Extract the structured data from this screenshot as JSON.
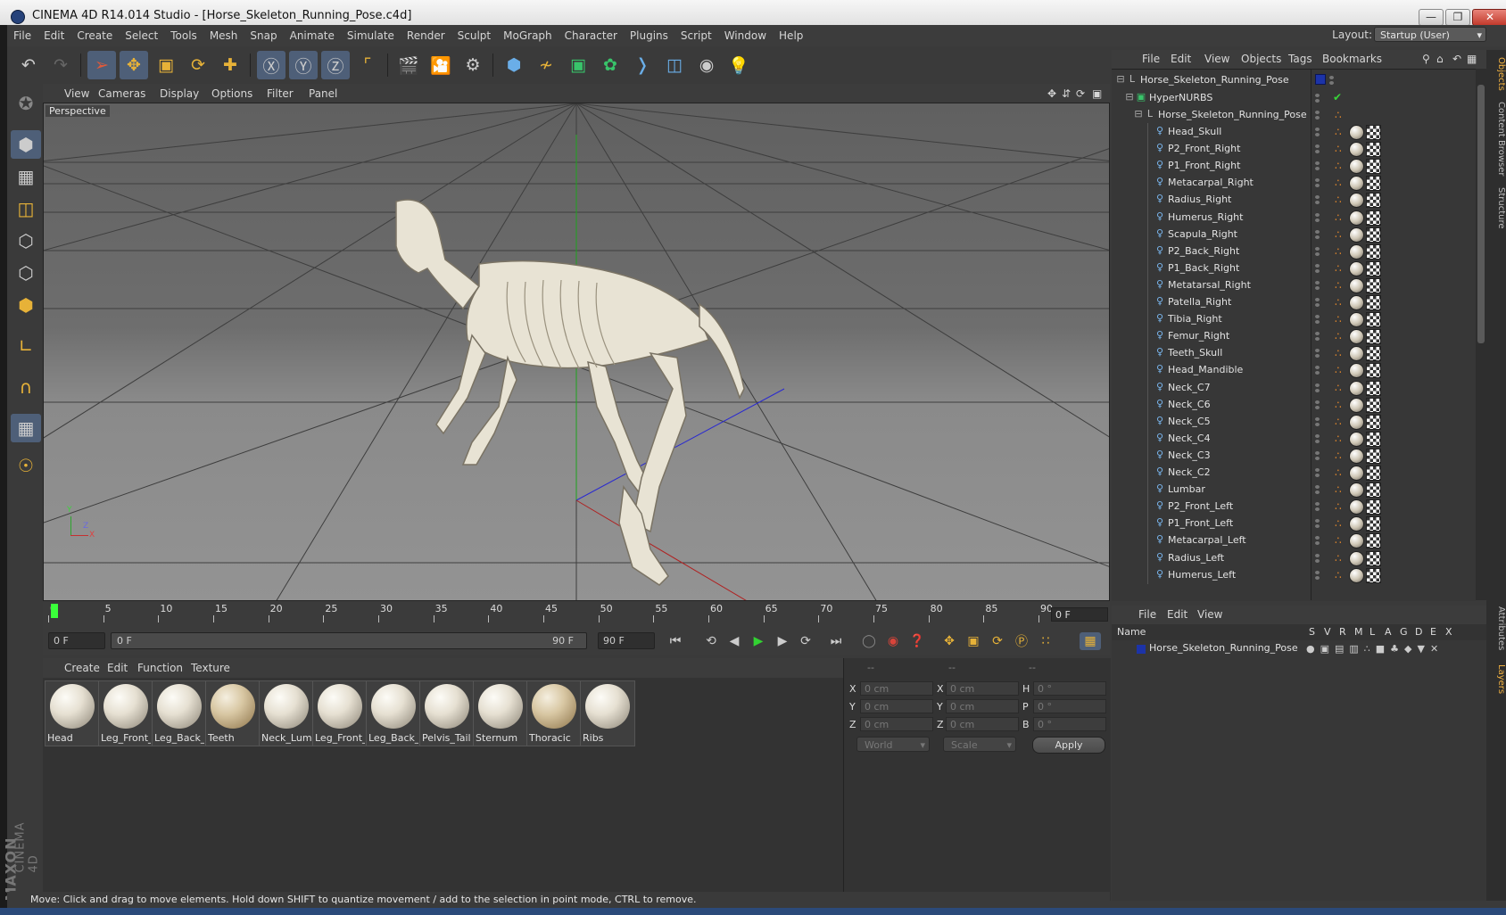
{
  "window": {
    "title": "CINEMA 4D R14.014 Studio - [Horse_Skeleton_Running_Pose.c4d]"
  },
  "menubar": [
    "File",
    "Edit",
    "Create",
    "Select",
    "Tools",
    "Mesh",
    "Snap",
    "Animate",
    "Simulate",
    "Render",
    "Sculpt",
    "MoGraph",
    "Character",
    "Plugins",
    "Script",
    "Window",
    "Help"
  ],
  "layout": {
    "label": "Layout:",
    "value": "Startup (User)"
  },
  "viewport": {
    "menu": [
      "View",
      "Cameras",
      "Display",
      "Options",
      "Filter",
      "Panel"
    ],
    "label": "Perspective",
    "axis": {
      "x": "X",
      "y": "Y",
      "z": "Z"
    }
  },
  "timeline": {
    "ticks": [
      "0",
      "5",
      "10",
      "15",
      "20",
      "25",
      "30",
      "35",
      "40",
      "45",
      "50",
      "55",
      "60",
      "65",
      "70",
      "75",
      "80",
      "85",
      "90"
    ],
    "current_frame": "0 F",
    "start_field": "0 F",
    "range_start": "0 F",
    "range_end": "90 F",
    "end_field": "90 F"
  },
  "material_manager": {
    "menu": [
      "Create",
      "Edit",
      "Function",
      "Texture"
    ],
    "materials": [
      {
        "label": "Head",
        "spots": false
      },
      {
        "label": "Leg_Front_",
        "spots": false
      },
      {
        "label": "Leg_Back_F",
        "spots": false
      },
      {
        "label": "Teeth",
        "spots": true
      },
      {
        "label": "Neck_Lumb",
        "spots": false
      },
      {
        "label": "Leg_Front_",
        "spots": false
      },
      {
        "label": "Leg_Back_L",
        "spots": false
      },
      {
        "label": "Pelvis_Tail",
        "spots": false
      },
      {
        "label": "Sternum",
        "spots": false
      },
      {
        "label": "Thoracic",
        "spots": true
      },
      {
        "label": "Ribs",
        "spots": false
      }
    ]
  },
  "coordinates": {
    "headers": [
      "--",
      "--",
      "--"
    ],
    "rows": [
      {
        "l1": "X",
        "v1": "0 cm",
        "l2": "X",
        "v2": "0 cm",
        "l3": "H",
        "v3": "0 °"
      },
      {
        "l1": "Y",
        "v1": "0 cm",
        "l2": "Y",
        "v2": "0 cm",
        "l3": "P",
        "v3": "0 °"
      },
      {
        "l1": "Z",
        "v1": "0 cm",
        "l2": "Z",
        "v2": "0 cm",
        "l3": "B",
        "v3": "0 °"
      }
    ],
    "space": "World",
    "mode": "Scale",
    "apply": "Apply"
  },
  "status": "Move: Click and drag to move elements. Hold down SHIFT to quantize movement / add to the selection in point mode, CTRL to remove.",
  "object_manager": {
    "menu": [
      "File",
      "Edit",
      "View",
      "Objects",
      "Tags",
      "Bookmarks"
    ],
    "root": "Horse_Skeleton_Running_Pose",
    "hypernurbs": "HyperNURBS",
    "group": "Horse_Skeleton_Running_Pose",
    "bones": [
      "Head_Skull",
      "P2_Front_Right",
      "P1_Front_Right",
      "Metacarpal_Right",
      "Radius_Right",
      "Humerus_Right",
      "Scapula_Right",
      "P2_Back_Right",
      "P1_Back_Right",
      "Metatarsal_Right",
      "Patella_Right",
      "Tibia_Right",
      "Femur_Right",
      "Teeth_Skull",
      "Head_Mandible",
      "Neck_C7",
      "Neck_C6",
      "Neck_C5",
      "Neck_C4",
      "Neck_C3",
      "Neck_C2",
      "Lumbar",
      "P2_Front_Left",
      "P1_Front_Left",
      "Metacarpal_Left",
      "Radius_Left",
      "Humerus_Left"
    ]
  },
  "layer_manager": {
    "menu": [
      "File",
      "Edit",
      "View"
    ],
    "columns": [
      "Name",
      "S",
      "V",
      "R",
      "M",
      "L",
      "A",
      "G",
      "D",
      "E",
      "X"
    ],
    "layer": "Horse_Skeleton_Running_Pose",
    "layer_color": "#1c33a8"
  },
  "right_tabs": [
    "Objects",
    "Content Browser",
    "Structure",
    "Attributes",
    "Layers"
  ],
  "colors": {
    "accent": "#4e5f78",
    "playhead": "#3aff3a",
    "bone_tag": "#e98a2b"
  }
}
